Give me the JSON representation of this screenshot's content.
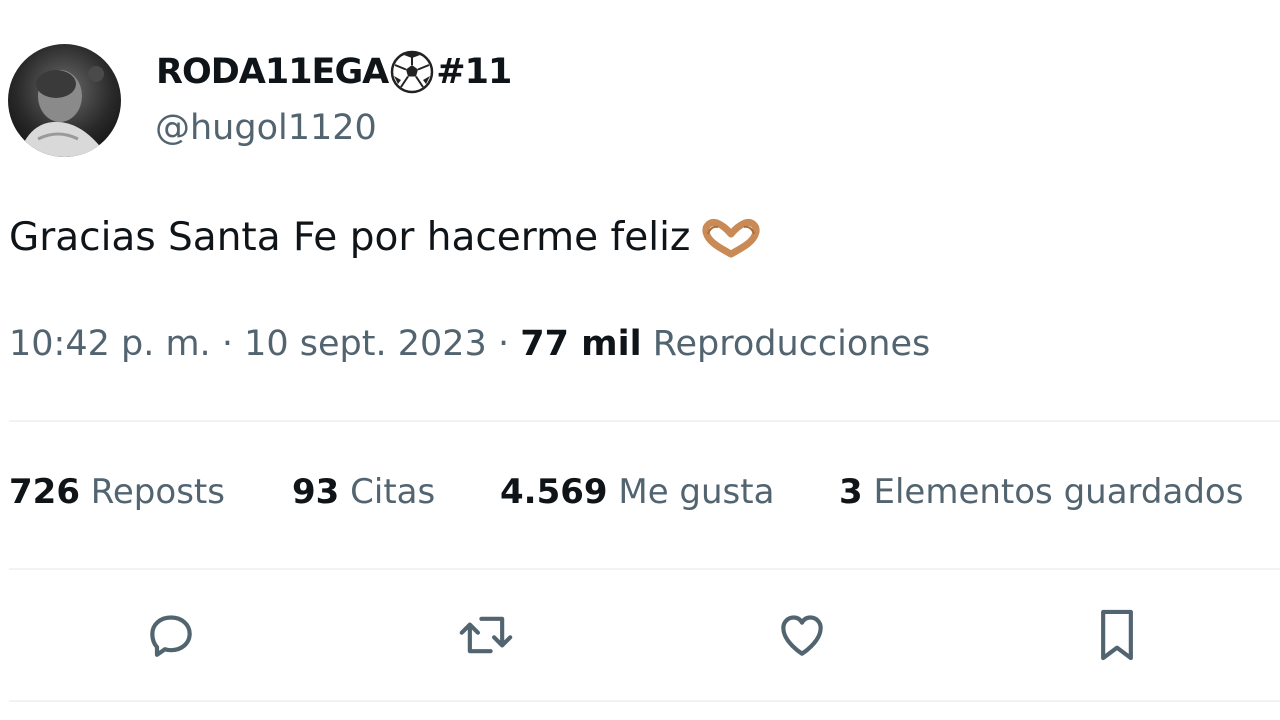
{
  "author": {
    "display_name_prefix": "RODA11EGA",
    "display_name_suffix": "#11",
    "handle": "@hugol1120",
    "avatar_icon": "profile-photo"
  },
  "tweet": {
    "text": "Gracias Santa Fe por hacerme feliz",
    "emoji_icon": "heart-hands-icon",
    "time": "10:42 p. m.",
    "separator": "·",
    "date": "10 sept. 2023",
    "views_count": "77 mil",
    "views_label": "Reproducciones"
  },
  "stats": {
    "reposts": {
      "count": "726",
      "label": "Reposts"
    },
    "quotes": {
      "count": "93",
      "label": "Citas"
    },
    "likes": {
      "count": "4.569",
      "label": "Me gusta"
    },
    "bookmarks": {
      "count": "3",
      "label": "Elementos guardados"
    }
  },
  "actions": [
    "reply-icon",
    "repost-icon",
    "like-icon",
    "bookmark-icon"
  ],
  "colors": {
    "primary_text": "#0f1419",
    "secondary_text": "#536471",
    "divider": "#eff3f4"
  }
}
